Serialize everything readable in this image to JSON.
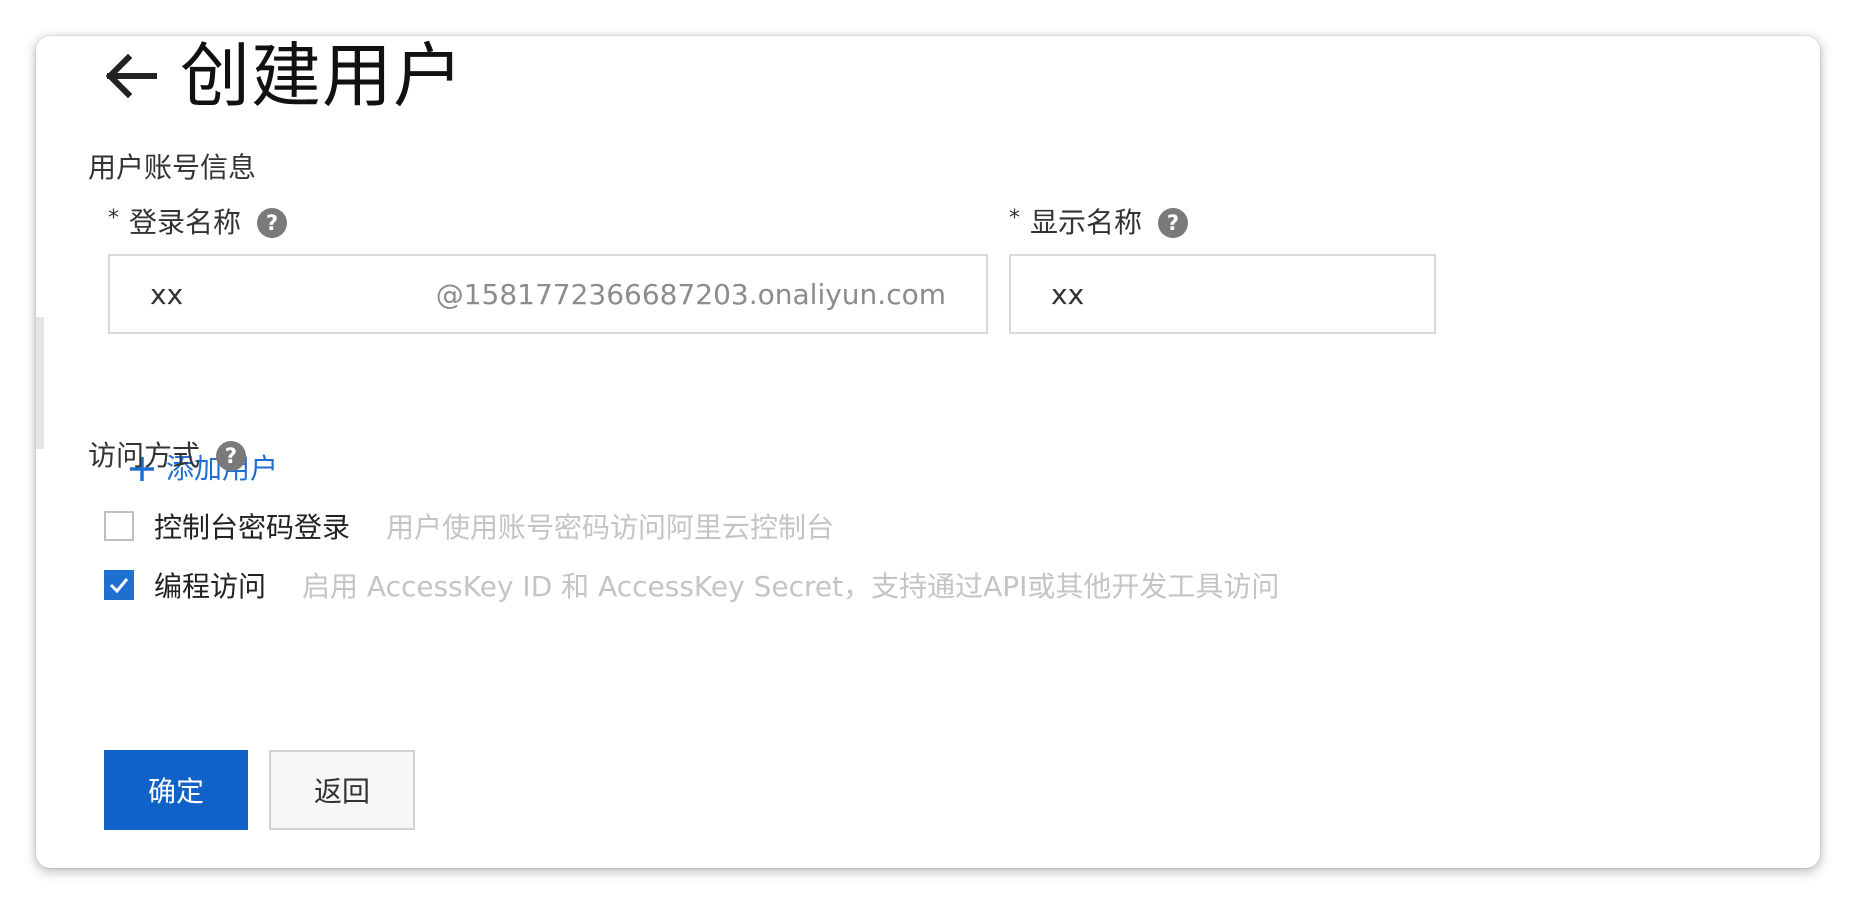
{
  "header": {
    "title": "创建用户"
  },
  "account_section": {
    "title": "用户账号信息",
    "login_name": {
      "required_mark": "*",
      "label": "登录名称",
      "value": "xx",
      "domain_suffix": "@1581772366687203.onaliyun.com"
    },
    "display_name": {
      "required_mark": "*",
      "label": "显示名称",
      "value": "xx"
    },
    "add_user_label": "添加用户"
  },
  "access_section": {
    "title": "访问方式",
    "options": [
      {
        "label": "控制台密码登录",
        "description": "用户使用账号密码访问阿里云控制台",
        "checked": false
      },
      {
        "label": "编程访问",
        "description": "启用 AccessKey ID 和 AccessKey Secret，支持通过API或其他开发工具访问",
        "checked": true
      }
    ]
  },
  "actions": {
    "confirm_label": "确定",
    "back_label": "返回"
  },
  "icons": {
    "back": "arrow-left-icon",
    "help": "question-circle-icon",
    "add": "plus-icon",
    "check": "checkmark-icon"
  },
  "colors": {
    "accent": "#1062c8",
    "link": "#1f6fd1",
    "help_icon": "#7a7a7a",
    "muted_text": "#c4c4c4"
  },
  "help_glyph": "?"
}
